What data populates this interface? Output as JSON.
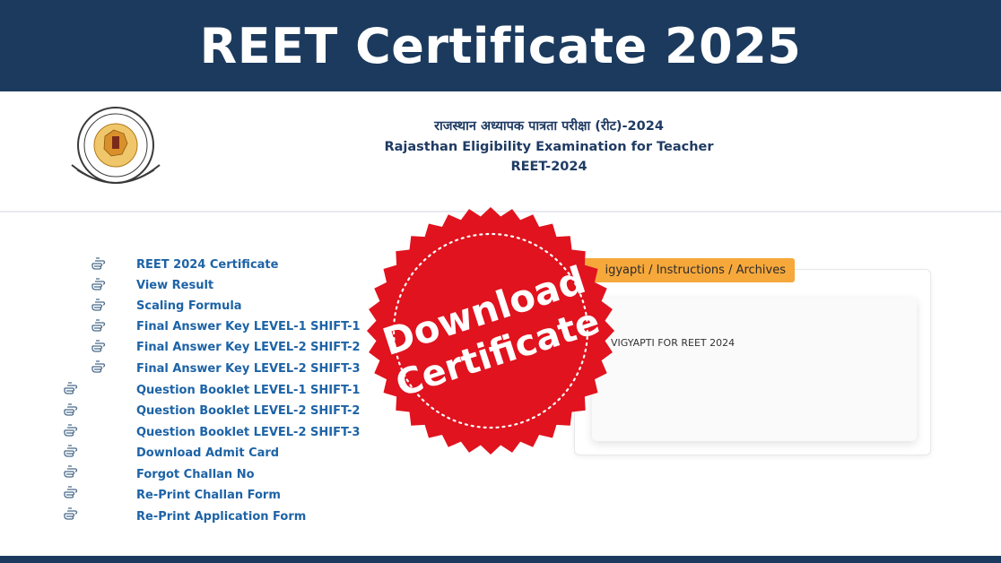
{
  "banner": {
    "title": "REET Certificate 2025"
  },
  "header": {
    "line_hindi": "राजस्थान अध्यापक पात्रता परीक्षा (रीट)-2024",
    "line_english": "Rajasthan Eligibility Examination for Teacher",
    "line_code": "REET-2024",
    "logo_icon": "rbse-seal-icon"
  },
  "links": [
    {
      "label": "REET 2024 Certificate",
      "icon": "pointing-hand-icon"
    },
    {
      "label": "View Result",
      "icon": "pointing-hand-icon"
    },
    {
      "label": "Scaling Formula",
      "icon": "pointing-hand-icon"
    },
    {
      "label": "Final Answer Key LEVEL-1 SHIFT-1",
      "icon": "pointing-hand-icon"
    },
    {
      "label": "Final Answer Key LEVEL-2 SHIFT-2",
      "icon": "pointing-hand-icon"
    },
    {
      "label": "Final Answer Key LEVEL-2 SHIFT-3",
      "icon": "pointing-hand-icon"
    },
    {
      "label": "Question Booklet LEVEL-1 SHIFT-1",
      "icon": "pointing-hand-icon"
    },
    {
      "label": "Question Booklet LEVEL-2 SHIFT-2",
      "icon": "pointing-hand-icon"
    },
    {
      "label": "Question Booklet LEVEL-2 SHIFT-3",
      "icon": "pointing-hand-icon"
    },
    {
      "label": "Download Admit Card",
      "icon": "pointing-hand-icon"
    },
    {
      "label": "Forgot Challan No",
      "icon": "pointing-hand-icon"
    },
    {
      "label": "Re-Print Challan Form",
      "icon": "pointing-hand-icon"
    },
    {
      "label": "Re-Print Application Form",
      "icon": "pointing-hand-icon"
    }
  ],
  "panel": {
    "tab_label": "igyapti / Instructions / Archives",
    "notice_text": "VIGYAPTI FOR REET 2024"
  },
  "seal": {
    "line1": "Download",
    "line2": "Certificate",
    "color": "#e0131e"
  },
  "colors": {
    "banner": "#1b3a5e",
    "link": "#1d63a6",
    "tab": "#f6a83b"
  }
}
